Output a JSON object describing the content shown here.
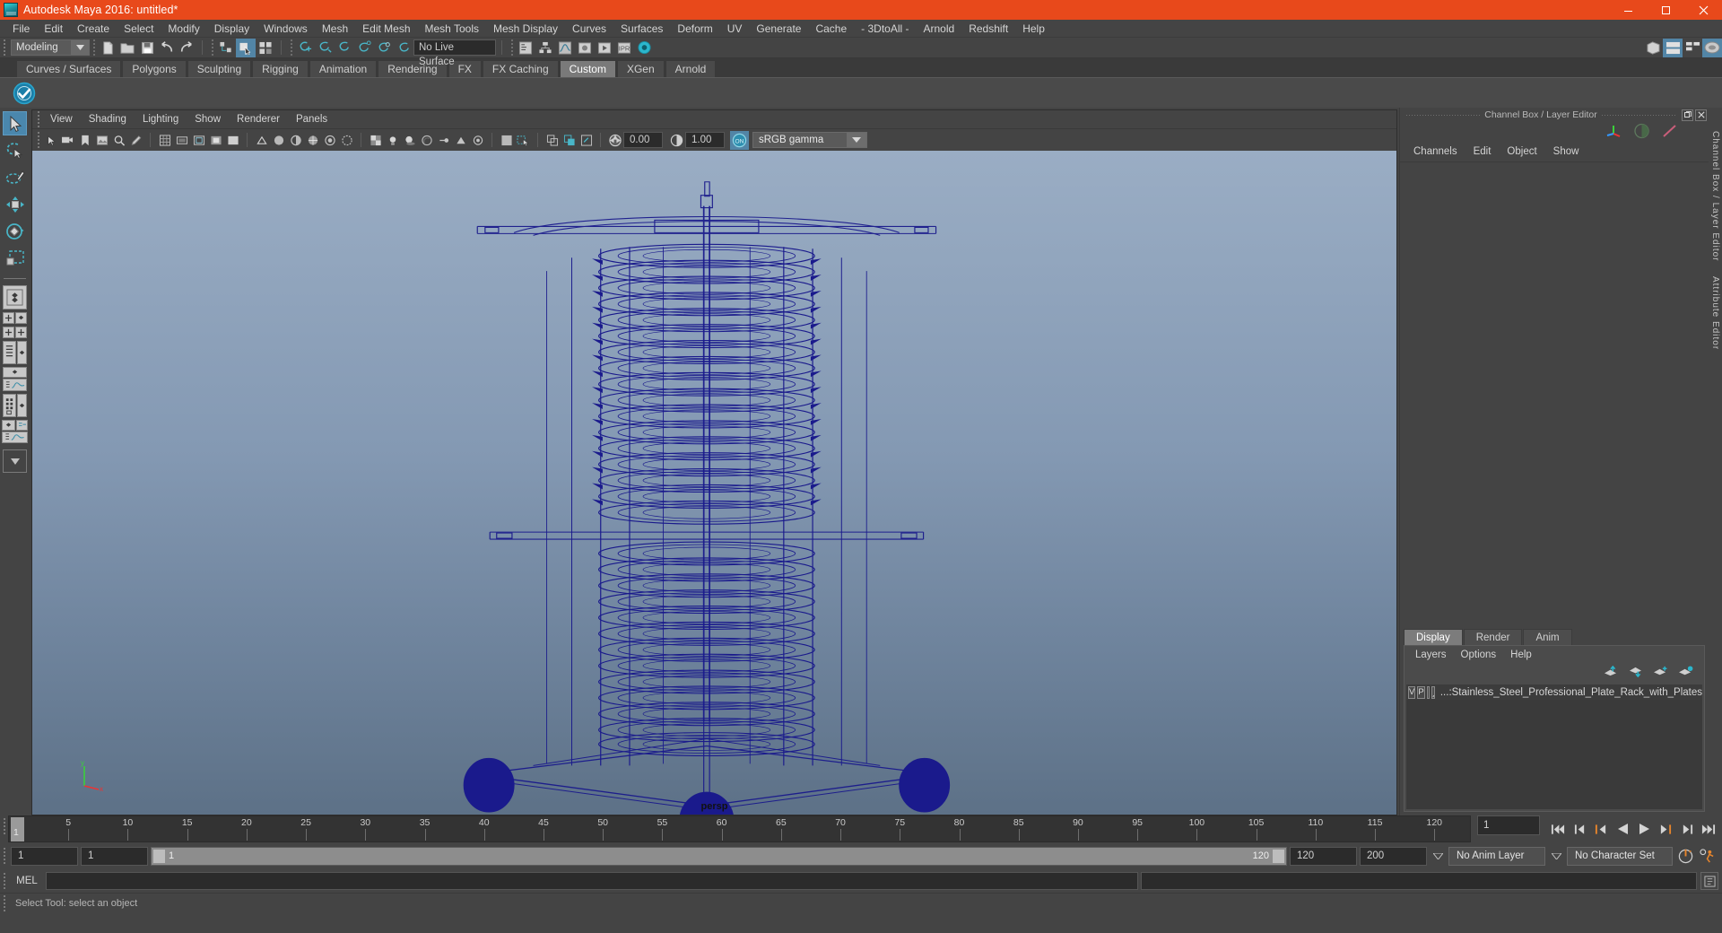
{
  "window": {
    "title": "Autodesk Maya 2016: untitled*",
    "minimize": "─",
    "maximize": "❑",
    "close": "✕"
  },
  "menubar": {
    "items": [
      {
        "label": "File"
      },
      {
        "label": "Edit"
      },
      {
        "label": "Create"
      },
      {
        "label": "Select"
      },
      {
        "label": "Modify"
      },
      {
        "label": "Display"
      },
      {
        "label": "Windows"
      },
      {
        "label": "Mesh"
      },
      {
        "label": "Edit Mesh"
      },
      {
        "label": "Mesh Tools"
      },
      {
        "label": "Mesh Display"
      },
      {
        "label": "Curves"
      },
      {
        "label": "Surfaces"
      },
      {
        "label": "Deform"
      },
      {
        "label": "UV"
      },
      {
        "label": "Generate"
      },
      {
        "label": "Cache"
      },
      {
        "label": "- 3DtoAll -"
      },
      {
        "label": "Arnold"
      },
      {
        "label": "Redshift"
      },
      {
        "label": "Help"
      }
    ]
  },
  "statusline": {
    "mode": "Modeling",
    "live_surface": "No Live Surface"
  },
  "shelf": {
    "tabs": [
      {
        "label": "Curves / Surfaces",
        "active": false
      },
      {
        "label": "Polygons",
        "active": false
      },
      {
        "label": "Sculpting",
        "active": false
      },
      {
        "label": "Rigging",
        "active": false
      },
      {
        "label": "Animation",
        "active": false
      },
      {
        "label": "Rendering",
        "active": false
      },
      {
        "label": "FX",
        "active": false
      },
      {
        "label": "FX Caching",
        "active": false
      },
      {
        "label": "Custom",
        "active": true
      },
      {
        "label": "XGen",
        "active": false
      },
      {
        "label": "Arnold",
        "active": false
      }
    ]
  },
  "viewport_panel": {
    "menus": [
      {
        "label": "View"
      },
      {
        "label": "Shading"
      },
      {
        "label": "Lighting"
      },
      {
        "label": "Show"
      },
      {
        "label": "Renderer"
      },
      {
        "label": "Panels"
      }
    ],
    "exposure_value": "0.00",
    "gamma_value": "1.00",
    "color_management": "sRGB gamma",
    "camera_label": "persp",
    "axis": {
      "x": "x",
      "y": "y",
      "z": "z"
    },
    "background_top": "#9aadc4",
    "background_bottom": "#5d7187",
    "wireframe_color": "#1a1a8c"
  },
  "channel_box": {
    "title": "Channel Box / Layer Editor",
    "menus": [
      {
        "label": "Channels"
      },
      {
        "label": "Edit"
      },
      {
        "label": "Object"
      },
      {
        "label": "Show"
      }
    ]
  },
  "layer_editor": {
    "tabs": [
      {
        "label": "Display",
        "active": true
      },
      {
        "label": "Render",
        "active": false
      },
      {
        "label": "Anim",
        "active": false
      }
    ],
    "menus": [
      {
        "label": "Layers"
      },
      {
        "label": "Options"
      },
      {
        "label": "Help"
      }
    ],
    "layers": [
      {
        "visibility": "V",
        "playback": "P",
        "name": "...:Stainless_Steel_Professional_Plate_Rack_with_Plates"
      }
    ]
  },
  "side_tabs": [
    {
      "label": "Channel Box / Layer Editor"
    },
    {
      "label": "Attribute Editor"
    }
  ],
  "timeline": {
    "ticks": [
      {
        "value": "5",
        "frame": 5
      },
      {
        "value": "10",
        "frame": 10
      },
      {
        "value": "15",
        "frame": 15
      },
      {
        "value": "20",
        "frame": 20
      },
      {
        "value": "25",
        "frame": 25
      },
      {
        "value": "30",
        "frame": 30
      },
      {
        "value": "35",
        "frame": 35
      },
      {
        "value": "40",
        "frame": 40
      },
      {
        "value": "45",
        "frame": 45
      },
      {
        "value": "50",
        "frame": 50
      },
      {
        "value": "55",
        "frame": 55
      },
      {
        "value": "60",
        "frame": 60
      },
      {
        "value": "65",
        "frame": 65
      },
      {
        "value": "70",
        "frame": 70
      },
      {
        "value": "75",
        "frame": 75
      },
      {
        "value": "80",
        "frame": 80
      },
      {
        "value": "85",
        "frame": 85
      },
      {
        "value": "90",
        "frame": 90
      },
      {
        "value": "95",
        "frame": 95
      },
      {
        "value": "100",
        "frame": 100
      },
      {
        "value": "105",
        "frame": 105
      },
      {
        "value": "110",
        "frame": 110
      },
      {
        "value": "115",
        "frame": 115
      },
      {
        "value": "120",
        "frame": 120
      }
    ],
    "current_frame": "1",
    "current_frame_field": "1",
    "range_start": "1",
    "anim_start": "1",
    "range_bar_start_label": "1",
    "range_bar_end_label": "120",
    "range_end": "120",
    "anim_end": "200",
    "anim_layer": "No Anim Layer",
    "character_set": "No Character Set"
  },
  "command_line": {
    "label": "MEL",
    "input_value": "",
    "placeholder": ""
  },
  "status": {
    "message": "Select Tool: select an object"
  }
}
